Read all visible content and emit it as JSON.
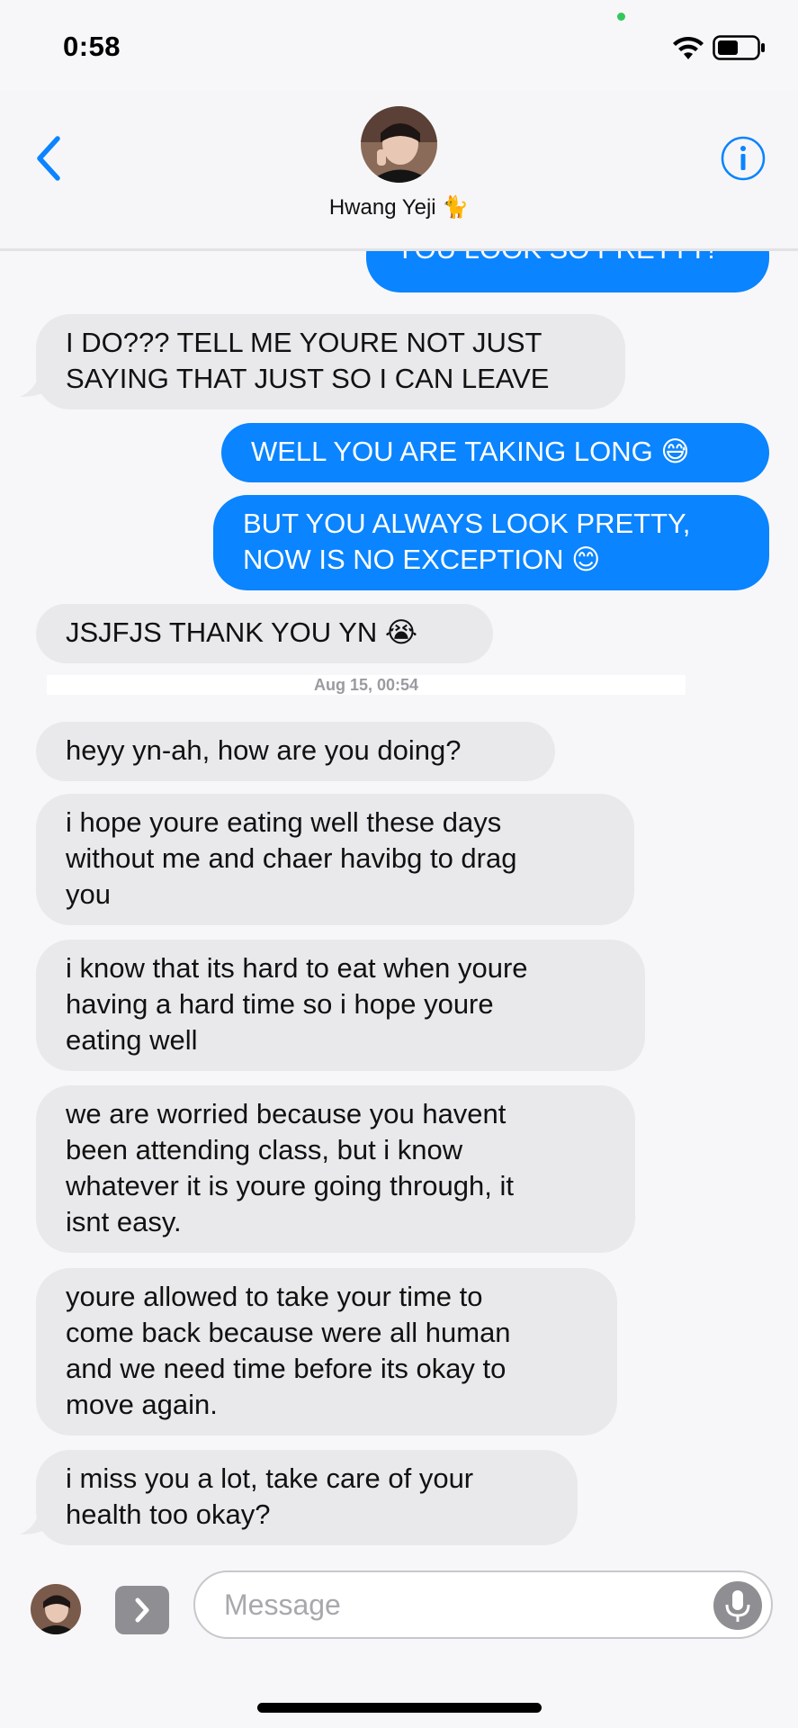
{
  "status_bar": {
    "time": "0:58"
  },
  "header": {
    "contact_name": "Hwang Yeji 🐈"
  },
  "messages": [
    {
      "dir": "out",
      "text": "YOU LOOK SO PRETTY!"
    },
    {
      "dir": "in",
      "text": "I DO??? TELL ME YOURE NOT JUST\nSAYING THAT JUST SO I CAN LEAVE"
    },
    {
      "dir": "out",
      "text": "WELL YOU ARE TAKING LONG 😅"
    },
    {
      "dir": "out",
      "text": "BUT YOU ALWAYS LOOK PRETTY,\nNOW IS NO EXCEPTION 😊"
    },
    {
      "dir": "in",
      "text": "JSJFJS THANK YOU YN 😭"
    },
    {
      "dir": "in",
      "text": "heyy yn-ah, how are you doing?"
    },
    {
      "dir": "in",
      "text": "i hope youre eating well these days\nwithout me and chaer havibg to drag\nyou"
    },
    {
      "dir": "in",
      "text": "i know that its hard to eat when youre\nhaving a hard time so i hope youre\neating well"
    },
    {
      "dir": "in",
      "text": "we are worried because you havent\nbeen attending class, but i know\nwhatever it is youre going through, it\nisnt easy."
    },
    {
      "dir": "in",
      "text": "youre allowed to take your time to\ncome back because were all human\nand we need time before its okay to\nmove again."
    },
    {
      "dir": "in",
      "text": "i miss you a lot, take care of your\nhealth too okay?"
    }
  ],
  "timestamp": "Aug 15, 00:54",
  "composer": {
    "placeholder": "Message"
  },
  "colors": {
    "accent": "#0a84ff",
    "incoming": "#e9e9eb",
    "outgoing_text": "#ffffff"
  },
  "icons": [
    "back-chevron-icon",
    "info-icon",
    "wifi-icon",
    "battery-icon",
    "app-store-icon",
    "mic-icon"
  ]
}
